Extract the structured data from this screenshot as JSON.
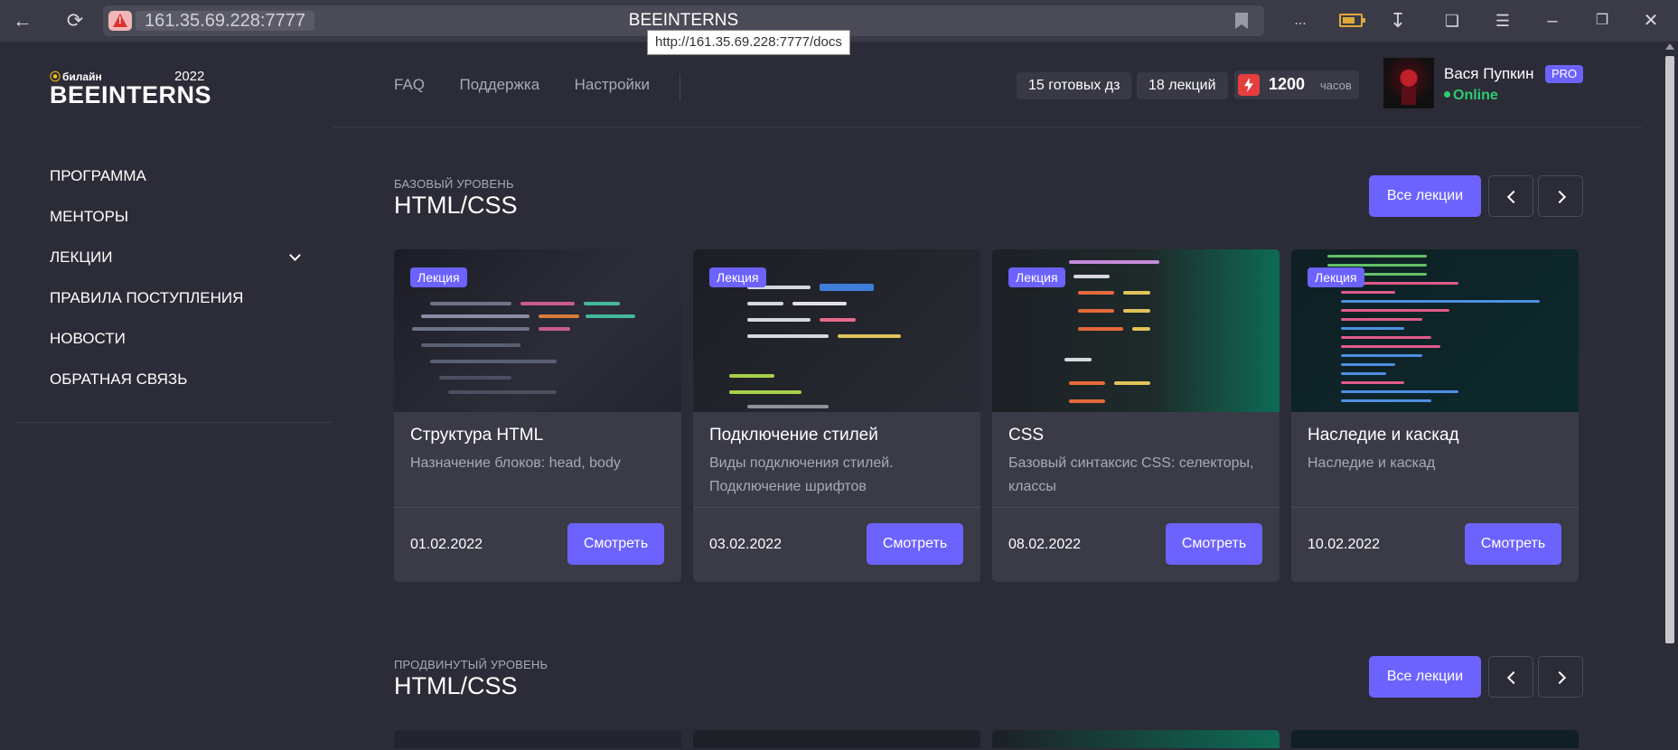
{
  "browser": {
    "url": "161.35.69.228:7777",
    "title": "BEEINTERNS",
    "tooltip": "http://161.35.69.228:7777/docs",
    "more_label": "..."
  },
  "sidebar": {
    "brand": "билайн",
    "year": "2022",
    "logo_text": "BEEINTERNS",
    "items": [
      {
        "label": "ПРОГРАММА"
      },
      {
        "label": "МЕНТОРЫ"
      },
      {
        "label": "ЛЕКЦИИ"
      },
      {
        "label": "ПРАВИЛА ПОСТУПЛЕНИЯ"
      },
      {
        "label": "НОВОСТИ"
      },
      {
        "label": "ОБРАТНАЯ СВЯЗЬ"
      }
    ]
  },
  "header": {
    "nav": [
      {
        "label": "FAQ"
      },
      {
        "label": "Поддержка"
      },
      {
        "label": "Настройки"
      }
    ],
    "stats": {
      "homework": "15 готовых дз",
      "lectures": "18 лекций",
      "hours_value": "1200",
      "hours_unit": "часов"
    },
    "user": {
      "name": "Вася Пупкин",
      "badge": "PRO",
      "status": "Online"
    }
  },
  "sections": [
    {
      "level": "БАЗОВЫЙ УРОВЕНЬ",
      "title": "HTML/CSS",
      "all_label": "Все лекции",
      "cards": [
        {
          "badge": "Лекция",
          "title": "Структура HTML",
          "desc": "Назначение блоков: head, body",
          "date": "01.02.2022",
          "button": "Смотреть"
        },
        {
          "badge": "Лекция",
          "title": "Подключение стилей",
          "desc": "Виды подключения стилей. Подключение шрифтов",
          "date": "03.02.2022",
          "button": "Смотреть"
        },
        {
          "badge": "Лекция",
          "title": "CSS",
          "desc": "Базовый синтаксис CSS: селекторы, классы",
          "date": "08.02.2022",
          "button": "Смотреть"
        },
        {
          "badge": "Лекция",
          "title": "Наследие и каскад",
          "desc": "Наследие и каскад",
          "date": "10.02.2022",
          "button": "Смотреть"
        }
      ]
    },
    {
      "level": "ПРОДВИНУТЫЙ УРОВЕНЬ",
      "title": "HTML/CSS",
      "all_label": "Все лекции"
    }
  ],
  "colors": {
    "accent": "#6c63ff",
    "background": "#2b2c37",
    "card": "#3a3b47",
    "online": "#2ecc71",
    "brand_yellow": "#f5c10a"
  }
}
